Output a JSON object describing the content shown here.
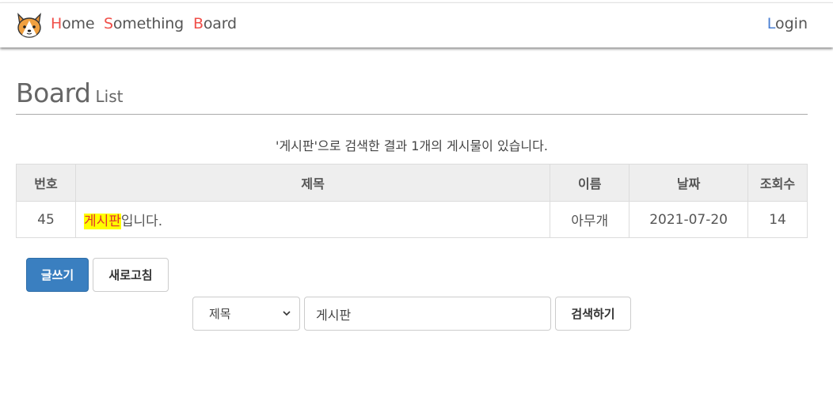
{
  "nav": {
    "home": {
      "first": "H",
      "rest": "ome"
    },
    "something": {
      "first": "S",
      "rest": "omething"
    },
    "board": {
      "first": "B",
      "rest": "oard"
    },
    "login": {
      "first": "L",
      "rest": "ogin"
    },
    "logo_icon": "corgi-icon"
  },
  "heading": {
    "title": "Board",
    "subtitle": "List"
  },
  "result_message": "'게시판'으로 검색한 결과 1개의 게시물이 있습니다.",
  "table": {
    "headers": [
      "번호",
      "제목",
      "이름",
      "날짜",
      "조회수"
    ],
    "rows": [
      {
        "no": "45",
        "title_highlight": "게시판",
        "title_rest": "입니다.",
        "name": "아무개",
        "date": "2021-07-20",
        "views": "14"
      }
    ]
  },
  "buttons": {
    "write": "글쓰기",
    "refresh": "새로고침",
    "search": "검색하기"
  },
  "search": {
    "select_value": "제목",
    "query": "게시판"
  },
  "colors": {
    "accent_red": "#f0504a",
    "accent_blue": "#4a7fd3",
    "primary_button": "#3a7fc0",
    "highlight": "#ffff00"
  }
}
